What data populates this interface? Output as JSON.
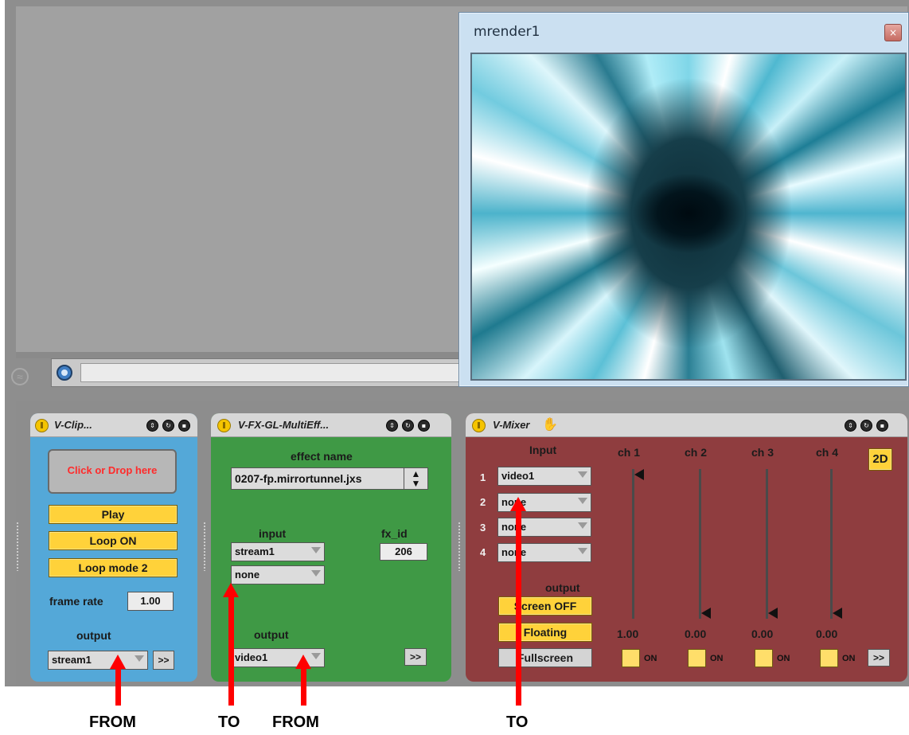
{
  "mrender": {
    "title": "mrender1",
    "close_glyph": "×"
  },
  "host": {
    "hot_swap_glyph": "≈"
  },
  "v_clip": {
    "title": "V-Clip...",
    "drop_zone": "Click or Drop here",
    "play": "Play",
    "loop": "Loop ON",
    "loop_mode": "Loop mode 2",
    "frame_rate_label": "frame rate",
    "frame_rate_value": "1.00",
    "output_label": "output",
    "output_value": "stream1",
    "forward_button": ">>"
  },
  "v_fx": {
    "title": "V-FX-GL-MultiEff...",
    "effect_name_label": "effect name",
    "effect_name_value": "0207-fp.mirrortunnel.jxs",
    "input_label": "input",
    "input_1": "stream1",
    "input_2": "none",
    "fx_id_label": "fx_id",
    "fx_id_value": "206",
    "output_label": "output",
    "output_value": "video1",
    "forward_button": ">>"
  },
  "v_mixer": {
    "title": "V-Mixer",
    "hand_icon": "hand-icon",
    "input_label": "Input",
    "inputs": [
      {
        "num": "1",
        "value": "video1"
      },
      {
        "num": "2",
        "value": "none"
      },
      {
        "num": "3",
        "value": "none"
      },
      {
        "num": "4",
        "value": "none"
      }
    ],
    "channels": [
      {
        "label": "ch 1",
        "value": "1.00",
        "level": 1.0,
        "on_label": "ON"
      },
      {
        "label": "ch 2",
        "value": "0.00",
        "level": 0.0,
        "on_label": "ON"
      },
      {
        "label": "ch 3",
        "value": "0.00",
        "level": 0.0,
        "on_label": "ON"
      },
      {
        "label": "ch 4",
        "value": "0.00",
        "level": 0.0,
        "on_label": "ON"
      }
    ],
    "mode_2d": "2D",
    "output_label": "output",
    "screen_button": "Screen OFF",
    "floating_button": "Floating",
    "fullscreen_button": "Fullscreen",
    "forward_button": ">>"
  },
  "annotations": [
    {
      "label": "FROM"
    },
    {
      "label": "TO"
    },
    {
      "label": "FROM"
    },
    {
      "label": "TO"
    }
  ],
  "colors": {
    "clip_panel": "#54a8d8",
    "fx_panel": "#3f9945",
    "mixer_panel": "#8f3d3f",
    "yellow_button": "#ffd23a",
    "arrow": "#ff0000"
  }
}
